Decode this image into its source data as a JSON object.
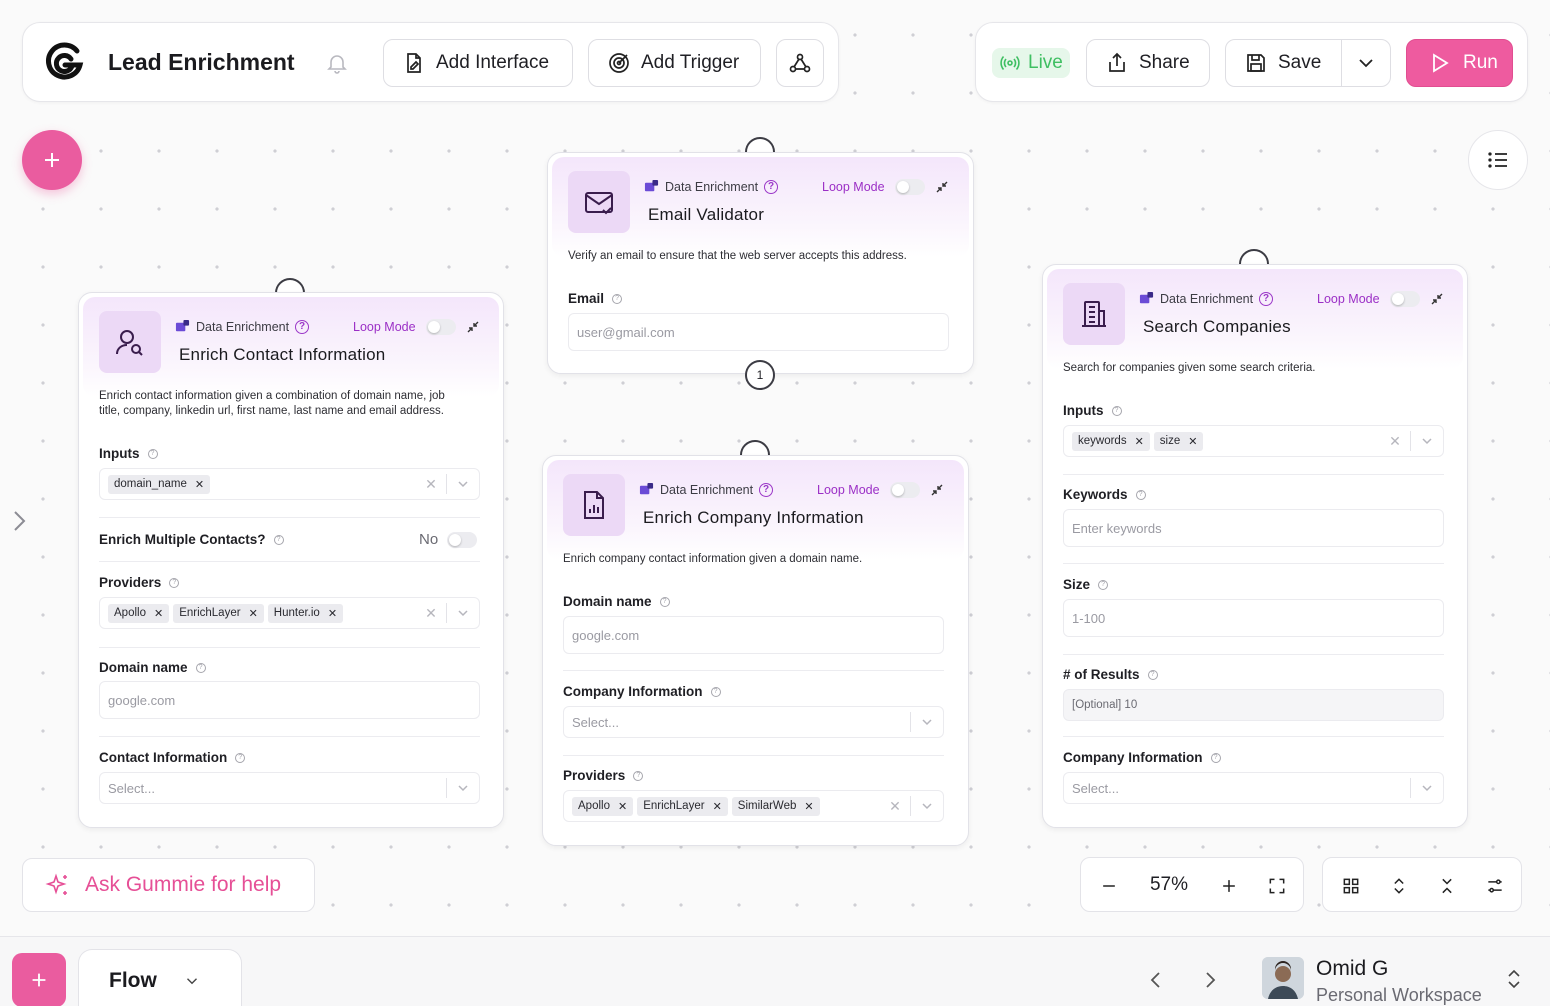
{
  "toolbar": {
    "title": "Lead Enrichment",
    "add_interface": "Add Interface",
    "add_trigger": "Add Trigger",
    "live": "Live",
    "share": "Share",
    "save": "Save",
    "run": "Run"
  },
  "colors": {
    "accent": "#ea5c9f",
    "live_green": "#3fbf62",
    "loop_mode_purple": "#9b2fc6",
    "node_header": "#f4e6fb"
  },
  "nodes": {
    "email_validator": {
      "category": "Data Enrichment",
      "loop_mode": "Loop Mode",
      "title": "Email Validator",
      "description": "Verify an email to ensure that the web server accepts this address.",
      "email_label": "Email",
      "email_placeholder": "user@gmail.com",
      "output_count": "1"
    },
    "enrich_contact": {
      "category": "Data Enrichment",
      "loop_mode": "Loop Mode",
      "title": "Enrich Contact Information",
      "description_line1": "Enrich contact information given a combination of domain name, job",
      "description_line2": "title, company, linkedin url, first name, last name and email address.",
      "inputs_label": "Inputs",
      "inputs_tags": [
        "domain_name"
      ],
      "multiple_label": "Enrich Multiple Contacts?",
      "multiple_value": "No",
      "providers_label": "Providers",
      "providers_tags": [
        "Apollo",
        "EnrichLayer",
        "Hunter.io"
      ],
      "domain_label": "Domain name",
      "domain_placeholder": "google.com",
      "contact_label": "Contact Information",
      "contact_placeholder": "Select..."
    },
    "enrich_company": {
      "category": "Data Enrichment",
      "loop_mode": "Loop Mode",
      "title": "Enrich Company Information",
      "description": "Enrich company contact information given a domain name.",
      "domain_label": "Domain name",
      "domain_placeholder": "google.com",
      "company_label": "Company Information",
      "company_placeholder": "Select...",
      "providers_label": "Providers",
      "providers_tags": [
        "Apollo",
        "EnrichLayer",
        "SimilarWeb"
      ]
    },
    "search_companies": {
      "category": "Data Enrichment",
      "loop_mode": "Loop Mode",
      "title": "Search Companies",
      "description": "Search for companies given some search criteria.",
      "inputs_label": "Inputs",
      "inputs_tags": [
        "keywords",
        "size"
      ],
      "keywords_label": "Keywords",
      "keywords_placeholder": "Enter keywords",
      "size_label": "Size",
      "size_placeholder": "1-100",
      "results_label": "# of Results",
      "results_placeholder": "[Optional] 10",
      "company_label": "Company Information",
      "company_placeholder": "Select..."
    }
  },
  "assistant": {
    "label": "Ask Gummie for help"
  },
  "zoom": {
    "level": "57%"
  },
  "bottom": {
    "tab": "Flow",
    "user_name": "Omid G",
    "workspace": "Personal Workspace"
  }
}
